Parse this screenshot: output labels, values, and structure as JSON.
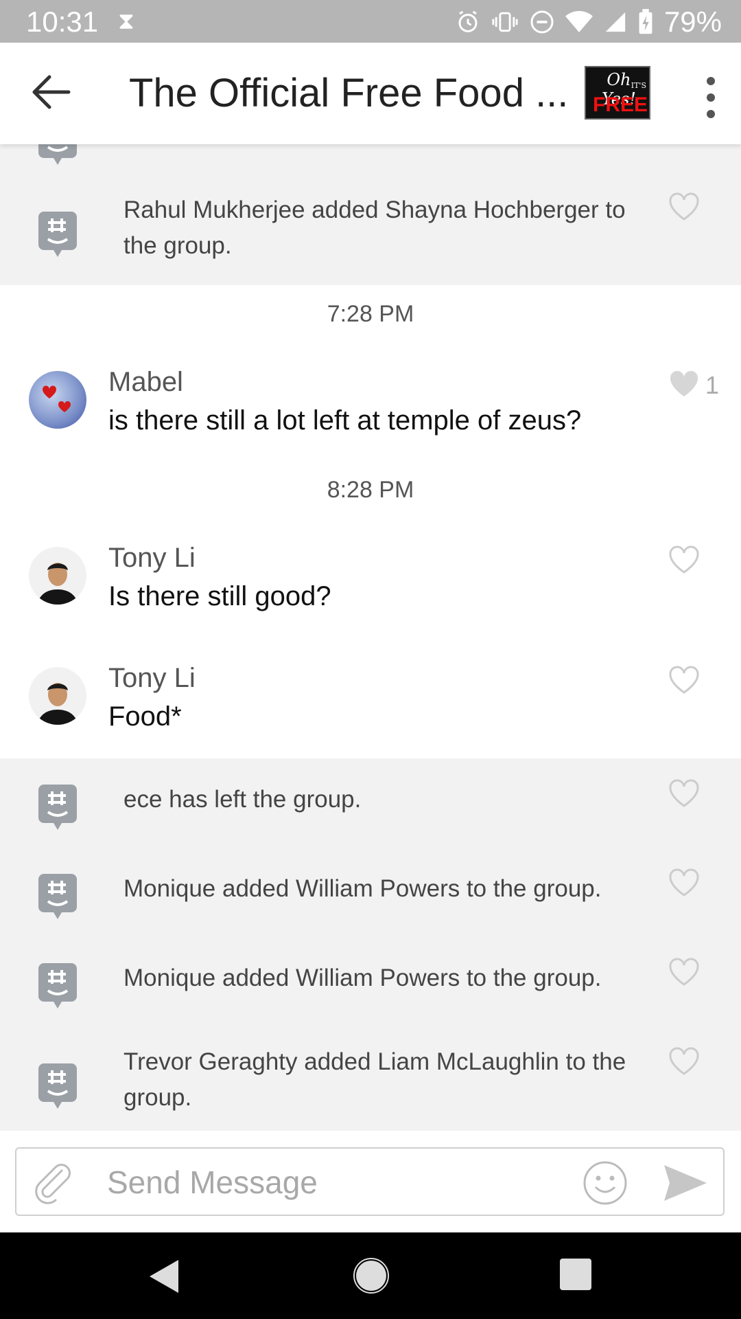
{
  "status_bar": {
    "time": "10:31",
    "battery_percent": "79%",
    "icons": [
      "hourglass-icon",
      "alarm-icon",
      "vibrate-icon",
      "dnd-icon",
      "wifi-icon",
      "signal-icon",
      "battery-charging-icon"
    ]
  },
  "header": {
    "title": "The Official Free Food ...",
    "avatar_text": {
      "line1": "Oh Yes!",
      "line2": "IT'S",
      "line3": "FREE"
    }
  },
  "feed": {
    "top_system_event": {
      "text": "Rahul Mukherjee added Shayna Hochberger to the group."
    },
    "separators": [
      "7:28 PM",
      "8:28 PM"
    ],
    "messages": [
      {
        "author": "Mabel",
        "text": "is there still a lot left at temple of zeus?",
        "likes": "1",
        "liked": true
      },
      {
        "author": "Tony Li",
        "text": "Is there still good?",
        "likes": "",
        "liked": false
      },
      {
        "author": "Tony Li",
        "text": "Food*",
        "likes": "",
        "liked": false
      }
    ],
    "system_events": [
      {
        "text": "ece has left the group."
      },
      {
        "text": "Monique added William Powers to the group."
      },
      {
        "text": "Monique added William Powers to the group."
      },
      {
        "text": "Trevor Geraghty added Liam McLaughlin to the group."
      }
    ]
  },
  "composer": {
    "placeholder": "Send Message",
    "value": ""
  },
  "colors": {
    "system_bg": "#f2f2f2",
    "heart_outline": "#cccccc",
    "heart_filled": "#d6d6d6",
    "status_bar": "#b5b5b5"
  }
}
